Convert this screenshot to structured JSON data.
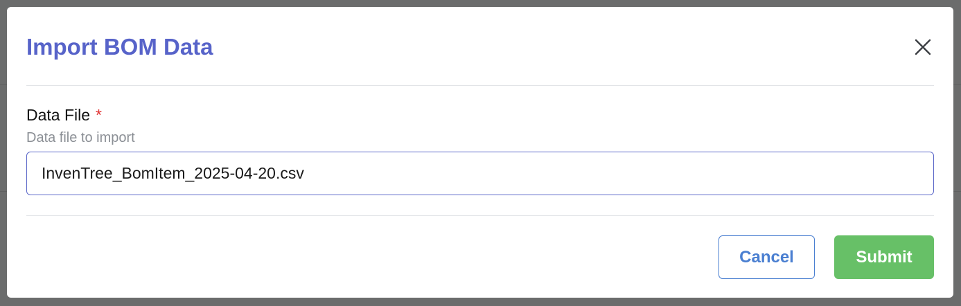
{
  "modal": {
    "title": "Import BOM Data",
    "close_icon": "close-icon",
    "field": {
      "label": "Data File",
      "required_marker": "*",
      "description": "Data file to import",
      "value": "InvenTree_BomItem_2025-04-20.csv"
    },
    "buttons": {
      "cancel_label": "Cancel",
      "submit_label": "Submit"
    }
  },
  "colors": {
    "title": "#5763c9",
    "required": "#e03131",
    "input_border": "#5c68c9",
    "cancel": "#4a7fd1",
    "submit": "#67c067",
    "backdrop": "#6b6c6c"
  }
}
